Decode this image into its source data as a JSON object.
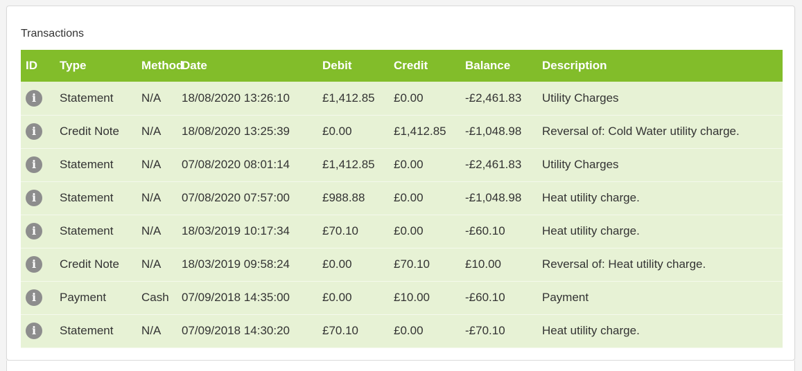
{
  "panel": {
    "title": "Transactions"
  },
  "table": {
    "columns": {
      "id": "ID",
      "type": "Type",
      "method": "Method",
      "date": "Date",
      "debit": "Debit",
      "credit": "Credit",
      "balance": "Balance",
      "description": "Description"
    },
    "rows": [
      {
        "icon": "info-icon",
        "type": "Statement",
        "method": "N/A",
        "date": "18/08/2020 13:26:10",
        "debit": "£1,412.85",
        "credit": "£0.00",
        "balance": "-£2,461.83",
        "description": "Utility Charges"
      },
      {
        "icon": "info-icon",
        "type": "Credit Note",
        "method": "N/A",
        "date": "18/08/2020 13:25:39",
        "debit": "£0.00",
        "credit": "£1,412.85",
        "balance": "-£1,048.98",
        "description": "Reversal of: Cold Water utility charge."
      },
      {
        "icon": "info-icon",
        "type": "Statement",
        "method": "N/A",
        "date": "07/08/2020 08:01:14",
        "debit": "£1,412.85",
        "credit": "£0.00",
        "balance": "-£2,461.83",
        "description": "Utility Charges"
      },
      {
        "icon": "info-icon",
        "type": "Statement",
        "method": "N/A",
        "date": "07/08/2020 07:57:00",
        "debit": "£988.88",
        "credit": "£0.00",
        "balance": "-£1,048.98",
        "description": "Heat utility charge."
      },
      {
        "icon": "info-icon",
        "type": "Statement",
        "method": "N/A",
        "date": "18/03/2019 10:17:34",
        "debit": "£70.10",
        "credit": "£0.00",
        "balance": "-£60.10",
        "description": "Heat utility charge."
      },
      {
        "icon": "info-icon",
        "type": "Credit Note",
        "method": "N/A",
        "date": "18/03/2019 09:58:24",
        "debit": "£0.00",
        "credit": "£70.10",
        "balance": "£10.00",
        "description": "Reversal of: Heat utility charge."
      },
      {
        "icon": "info-icon",
        "type": "Payment",
        "method": "Cash",
        "date": "07/09/2018 14:35:00",
        "debit": "£0.00",
        "credit": "£10.00",
        "balance": "-£60.10",
        "description": "Payment"
      },
      {
        "icon": "info-icon",
        "type": "Statement",
        "method": "N/A",
        "date": "07/09/2018 14:30:20",
        "debit": "£70.10",
        "credit": "£0.00",
        "balance": "-£70.10",
        "description": "Heat utility charge."
      }
    ]
  },
  "colors": {
    "header_green": "#82bd2a",
    "row_bg": "#e7f2d5",
    "icon_grey": "#8d8d8d"
  }
}
